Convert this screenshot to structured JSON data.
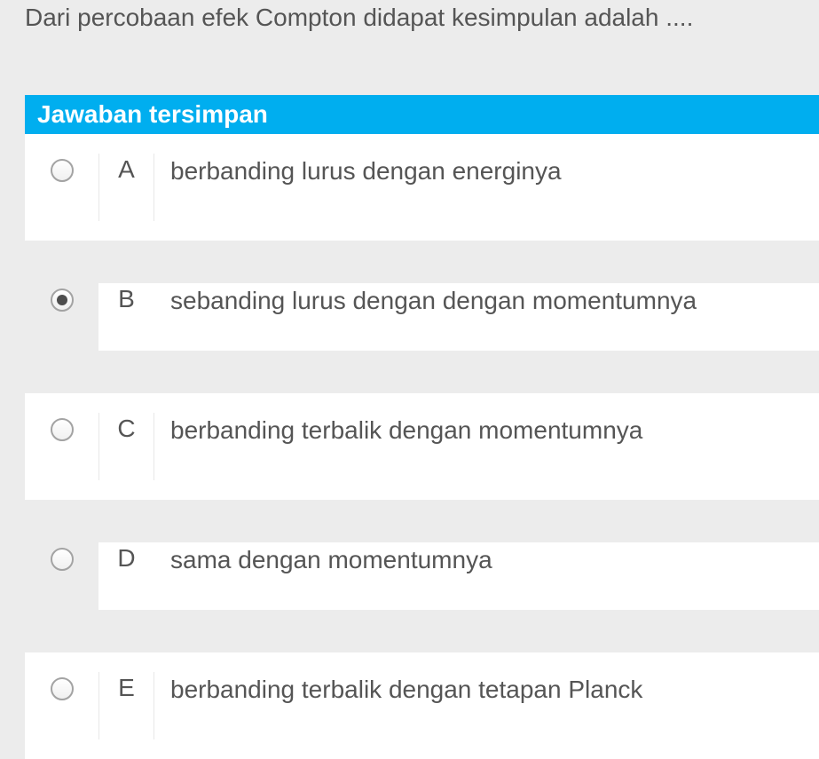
{
  "question": {
    "text": "Dari percobaan efek Compton didapat kesimpulan adalah ...."
  },
  "header": {
    "label": "Jawaban tersimpan"
  },
  "options": [
    {
      "letter": "A",
      "text": "berbanding lurus dengan energinya",
      "selected": false
    },
    {
      "letter": "B",
      "text": "sebanding lurus dengan dengan momentumnya",
      "selected": true
    },
    {
      "letter": "C",
      "text": "berbanding terbalik dengan momentumnya",
      "selected": false
    },
    {
      "letter": "D",
      "text": "sama dengan momentumnya",
      "selected": false
    },
    {
      "letter": "E",
      "text": "berbanding terbalik dengan tetapan Planck",
      "selected": false
    }
  ]
}
